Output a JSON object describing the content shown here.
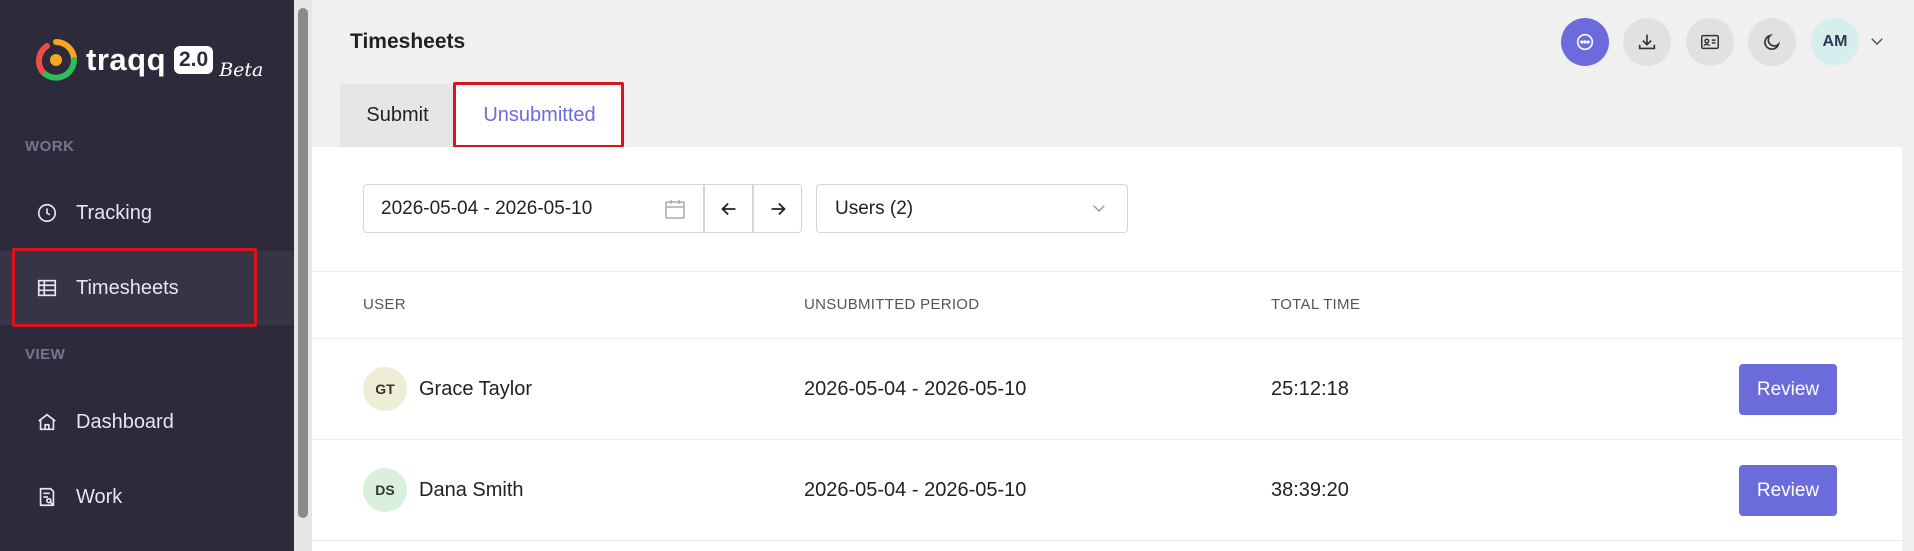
{
  "brand": {
    "name": "traqq",
    "version": "2.0",
    "tag": "Beta"
  },
  "sidebar": {
    "sections": [
      {
        "label": "WORK"
      },
      {
        "label": "VIEW"
      }
    ],
    "items": [
      {
        "label": "Tracking",
        "icon": "clock-icon"
      },
      {
        "label": "Timesheets",
        "icon": "grid-icon",
        "active": true
      },
      {
        "label": "Dashboard",
        "icon": "home-icon"
      },
      {
        "label": "Work",
        "icon": "report-icon"
      }
    ]
  },
  "header": {
    "title": "Timesheets",
    "user_initials": "AM",
    "buttons": [
      "chat-icon",
      "download-icon",
      "id-card-icon",
      "moon-icon"
    ]
  },
  "tabs": [
    {
      "label": "Submit"
    },
    {
      "label": "Unsubmitted",
      "active": true
    }
  ],
  "filters": {
    "date_range": "2026-05-04 - 2026-05-10",
    "users_select": "Users (2)"
  },
  "table": {
    "columns": [
      "USER",
      "UNSUBMITTED PERIOD",
      "TOTAL TIME"
    ],
    "rows": [
      {
        "initials": "GT",
        "name": "Grace Taylor",
        "period": "2026-05-04 - 2026-05-10",
        "total": "25:12:18",
        "action": "Review",
        "avatar_color": "#eeeed6"
      },
      {
        "initials": "DS",
        "name": "Dana Smith",
        "period": "2026-05-04 - 2026-05-10",
        "total": "38:39:20",
        "action": "Review",
        "avatar_color": "#d8f0dc"
      }
    ]
  },
  "colors": {
    "accent": "#6b6bdb",
    "sidebar_bg": "#2d2b3b",
    "highlight": "#d9141c"
  }
}
